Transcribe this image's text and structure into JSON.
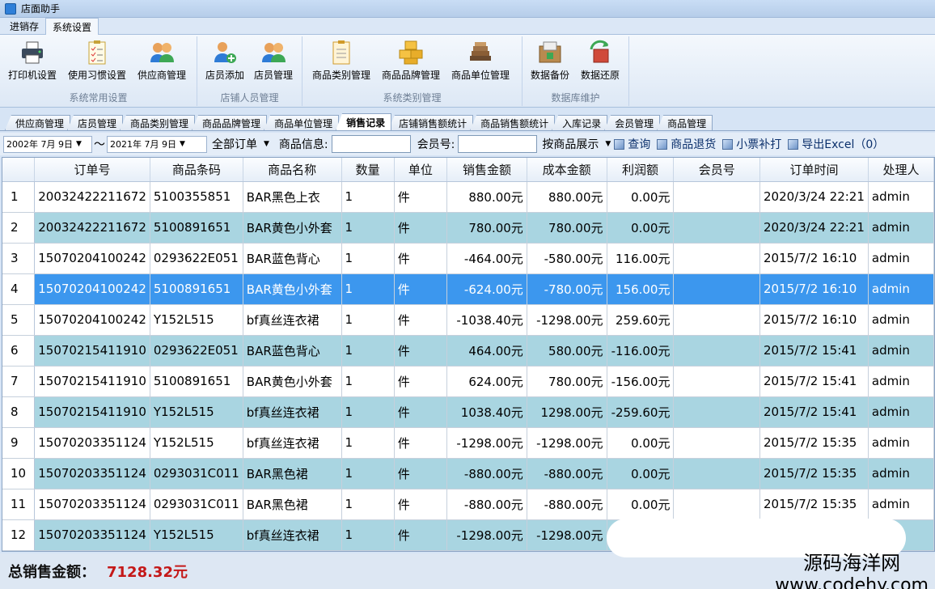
{
  "window": {
    "title": "店面助手"
  },
  "menu_tabs": [
    {
      "label": "进销存"
    },
    {
      "label": "系统设置"
    }
  ],
  "ribbon": {
    "groups": [
      {
        "name": "系统常用设置",
        "buttons": [
          {
            "label": "打印机设置",
            "icon": "printer-icon"
          },
          {
            "label": "使用习惯设置",
            "icon": "checklist-icon"
          },
          {
            "label": "供应商管理",
            "icon": "users-icon"
          }
        ]
      },
      {
        "name": "店铺人员管理",
        "buttons": [
          {
            "label": "店员添加",
            "icon": "user-add-icon"
          },
          {
            "label": "店员管理",
            "icon": "users-icon"
          }
        ]
      },
      {
        "name": "系统类别管理",
        "buttons": [
          {
            "label": "商品类别管理",
            "icon": "clipboard-icon"
          },
          {
            "label": "商品品牌管理",
            "icon": "boxes-icon"
          },
          {
            "label": "商品单位管理",
            "icon": "books-icon"
          }
        ]
      },
      {
        "name": "数据库维护",
        "buttons": [
          {
            "label": "数据备份",
            "icon": "backup-icon"
          },
          {
            "label": "数据还原",
            "icon": "restore-icon"
          }
        ]
      }
    ]
  },
  "page_tabs": [
    "供应商管理",
    "店员管理",
    "商品类别管理",
    "商品品牌管理",
    "商品单位管理",
    "销售记录",
    "店铺销售额统计",
    "商品销售额统计",
    "入库记录",
    "会员管理",
    "商品管理"
  ],
  "active_page_tab": "销售记录",
  "filter": {
    "date_from": "2002年 7月 9日",
    "range_sep": "～",
    "date_to": "2021年 7月 9日",
    "order_type": "全部订单",
    "goods_info_label": "商品信息:",
    "goods_info_value": "",
    "member_label": "会员号:",
    "member_value": "",
    "display_mode": "按商品展示",
    "actions": [
      "查询",
      "商品退货",
      "小票补打",
      "导出Excel（0）"
    ]
  },
  "table": {
    "columns": [
      "订单号",
      "商品条码",
      "商品名称",
      "数量",
      "单位",
      "销售金额",
      "成本金额",
      "利润额",
      "会员号",
      "订单时间",
      "处理人"
    ],
    "rows": [
      {
        "n": "1",
        "cells": [
          "20032422211672",
          "5100355851",
          "BAR黑色上衣",
          "1",
          "件",
          "880.00元",
          "880.00元",
          "0.00元",
          "",
          "2020/3/24 22:21",
          "admin"
        ]
      },
      {
        "n": "2",
        "cells": [
          "20032422211672",
          "5100891651",
          "BAR黄色小外套",
          "1",
          "件",
          "780.00元",
          "780.00元",
          "0.00元",
          "",
          "2020/3/24 22:21",
          "admin"
        ]
      },
      {
        "n": "3",
        "cells": [
          "15070204100242",
          "0293622E051",
          "BAR蓝色背心",
          "1",
          "件",
          "-464.00元",
          "-580.00元",
          "116.00元",
          "",
          "2015/7/2 16:10",
          "admin"
        ]
      },
      {
        "n": "4",
        "cells": [
          "15070204100242",
          "5100891651",
          "BAR黄色小外套",
          "1",
          "件",
          "-624.00元",
          "-780.00元",
          "156.00元",
          "",
          "2015/7/2 16:10",
          "admin"
        ]
      },
      {
        "n": "5",
        "cells": [
          "15070204100242",
          "Y152L515",
          "bf真丝连衣裙",
          "1",
          "件",
          "-1038.40元",
          "-1298.00元",
          "259.60元",
          "",
          "2015/7/2 16:10",
          "admin"
        ]
      },
      {
        "n": "6",
        "cells": [
          "15070215411910",
          "0293622E051",
          "BAR蓝色背心",
          "1",
          "件",
          "464.00元",
          "580.00元",
          "-116.00元",
          "",
          "2015/7/2 15:41",
          "admin"
        ]
      },
      {
        "n": "7",
        "cells": [
          "15070215411910",
          "5100891651",
          "BAR黄色小外套",
          "1",
          "件",
          "624.00元",
          "780.00元",
          "-156.00元",
          "",
          "2015/7/2 15:41",
          "admin"
        ]
      },
      {
        "n": "8",
        "cells": [
          "15070215411910",
          "Y152L515",
          "bf真丝连衣裙",
          "1",
          "件",
          "1038.40元",
          "1298.00元",
          "-259.60元",
          "",
          "2015/7/2 15:41",
          "admin"
        ]
      },
      {
        "n": "9",
        "cells": [
          "15070203351124",
          "Y152L515",
          "bf真丝连衣裙",
          "1",
          "件",
          "-1298.00元",
          "-1298.00元",
          "0.00元",
          "",
          "2015/7/2 15:35",
          "admin"
        ]
      },
      {
        "n": "10",
        "cells": [
          "15070203351124",
          "0293031C011",
          "BAR黑色裙",
          "1",
          "件",
          "-880.00元",
          "-880.00元",
          "0.00元",
          "",
          "2015/7/2 15:35",
          "admin"
        ]
      },
      {
        "n": "11",
        "cells": [
          "15070203351124",
          "0293031C011",
          "BAR黑色裙",
          "1",
          "件",
          "-880.00元",
          "-880.00元",
          "0.00元",
          "",
          "2015/7/2 15:35",
          "admin"
        ]
      },
      {
        "n": "12",
        "cells": [
          "15070203351124",
          "Y152L515",
          "bf真丝连衣裙",
          "1",
          "件",
          "-1298.00元",
          "-1298.00元",
          "",
          "",
          "",
          ""
        ]
      }
    ],
    "selected_row": 4
  },
  "footer": {
    "total_label": "总销售金额：",
    "total_value": "7128.32元"
  },
  "watermark": {
    "line1": "源码海洋网",
    "line2": "www.codehy.com"
  },
  "colors": {
    "alt_row": "#a9d5e1",
    "selected_row": "#3c97ee",
    "total_value": "#c41818"
  }
}
